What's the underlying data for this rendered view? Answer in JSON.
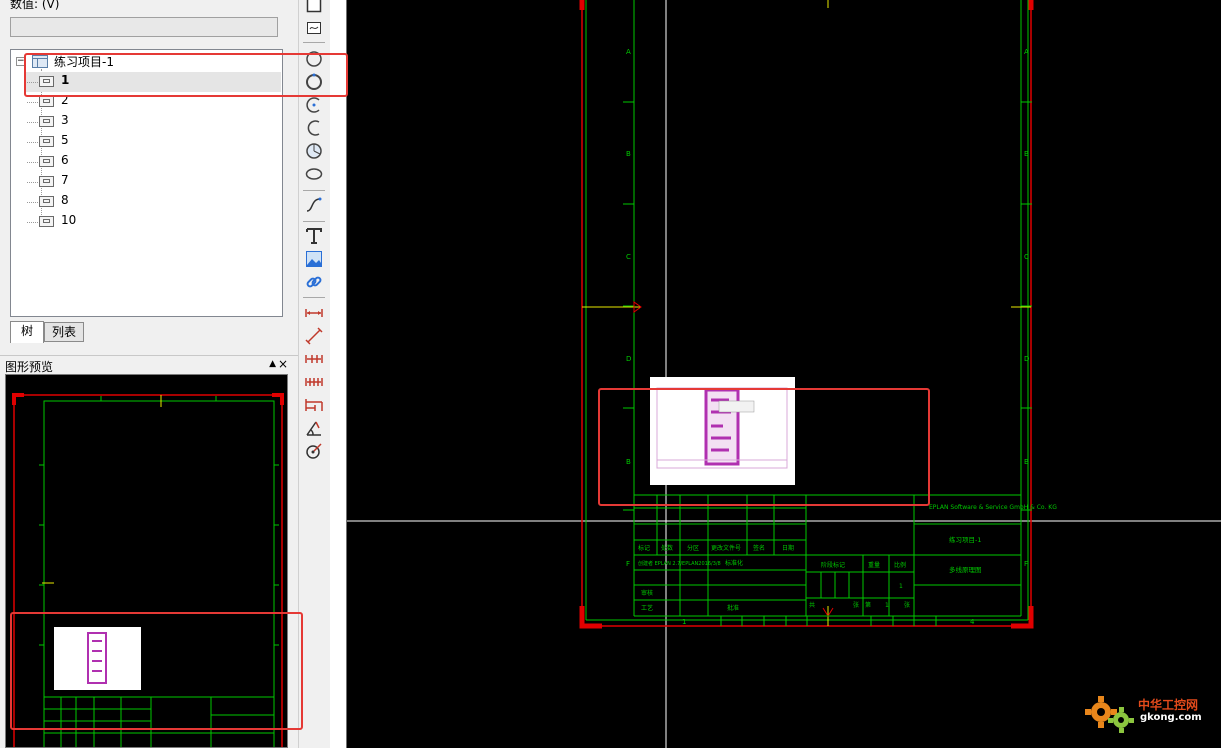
{
  "left_panel": {
    "value_label": "数值: (V)",
    "value_input": "",
    "tree": {
      "root_label": "练习项目-1",
      "expander": "−",
      "items": [
        {
          "label": "1",
          "selected": true
        },
        {
          "label": "2"
        },
        {
          "label": "3"
        },
        {
          "label": "5"
        },
        {
          "label": "6"
        },
        {
          "label": "7"
        },
        {
          "label": "8"
        },
        {
          "label": "10"
        }
      ]
    },
    "tabs": {
      "tree": "树",
      "list": "列表"
    },
    "preview": {
      "title": "图形预览",
      "pin": "▲",
      "close": "×"
    }
  },
  "toolbar": {
    "tools": [
      "rectangle-icon",
      "image-frame-icon",
      "circle-icon",
      "circle-thick-icon",
      "arc-three-point-icon",
      "arc-icon",
      "circle-sector-icon",
      "ellipse-icon",
      "spline-icon",
      "text-icon",
      "image-icon",
      "hyperlink-icon",
      "dimension-linear-icon",
      "dimension-aligned-icon",
      "dimension-chain-icon",
      "dimension-incremental-icon",
      "dimension-baseline-icon",
      "dimension-angle-icon",
      "dimension-radius-icon"
    ]
  },
  "drawing": {
    "row_labels": [
      "A",
      "B",
      "C",
      "D",
      "E",
      "F"
    ],
    "column_labels": [
      "1",
      "4"
    ],
    "title_block": {
      "company": "EPLAN Software & Service GmbH & Co. KG",
      "project": "练习项目-1",
      "page_description": "多线原理图",
      "headers": [
        "标记",
        "处数",
        "分区",
        "更改文件号",
        "签名",
        "日期"
      ],
      "row_create": "创建者 EPLAN 2.7/EPLAN2016/3/8",
      "standardize": "标准化",
      "check": "审核",
      "process": "工艺",
      "approve": "批准",
      "stage_mark": "阶段标记",
      "weight": "重量",
      "scale": "比例",
      "scale_value": "1",
      "total": "共",
      "sheet": "张",
      "page_label": "第",
      "page_value": "1"
    }
  },
  "watermark": {
    "title": "中华工控网",
    "url": "gkong.com"
  },
  "colors": {
    "cad_green": "#00c800",
    "cad_yellow": "#e8e800",
    "highlight_red": "#e53935",
    "sheet_red": "#e00000"
  }
}
